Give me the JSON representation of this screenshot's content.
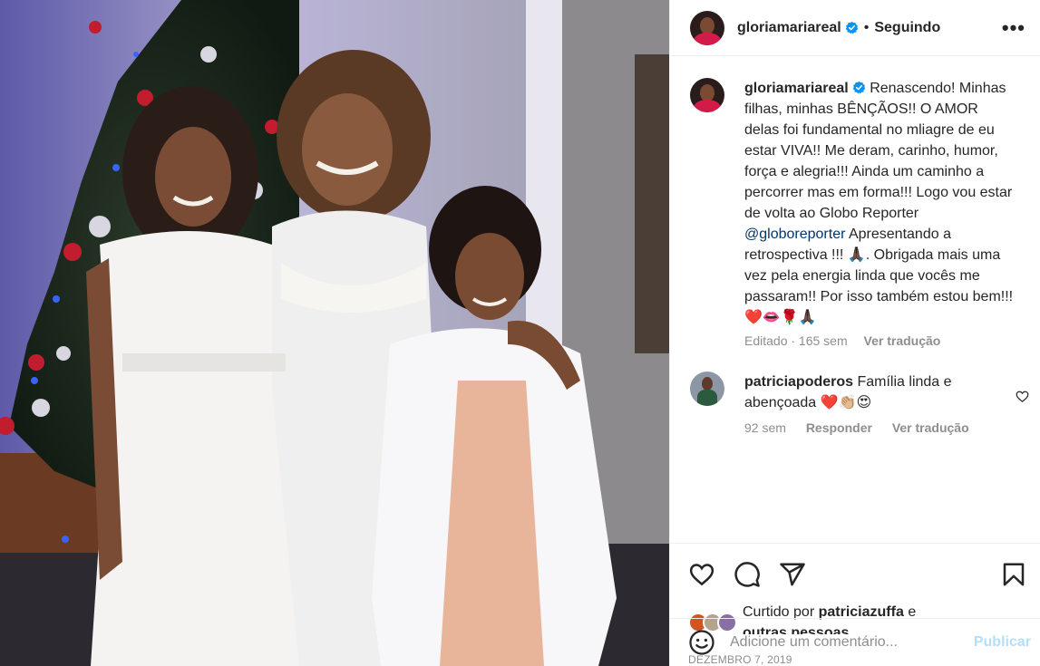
{
  "header": {
    "username": "gloriamariareal",
    "separator": "•",
    "follow_status": "Seguindo",
    "more_label": "•••"
  },
  "caption": {
    "username": "gloriamariareal",
    "text_before_mention": "Renascendo! Minhas filhas, minhas BÊNÇÃOS!! O AMOR delas foi fundamental no mliagre de eu estar VIVA!! Me deram, carinho, humor, força e alegria!!! Ainda um caminho a percorrer mas em forma!!! Logo vou estar de volta ao Globo Reporter",
    "mention": "@globoreporter",
    "text_after_mention": "Apresentando a retrospectiva !!! 🙏🏿. Obrigada mais uma vez pela energia linda que vocês me passaram!! Por isso também estou bem!!! ❤️👄🌹🙏🏿",
    "edited": "Editado · 165 sem",
    "translate": "Ver tradução"
  },
  "comment": {
    "username": "patriciapoderos",
    "text": "Família linda e abençoada ❤️👏🏼😍",
    "time": "92 sem",
    "reply": "Responder",
    "translate": "Ver tradução"
  },
  "likes": {
    "prefix": "Curtido por",
    "user": "patriciazuffa",
    "conj": "e",
    "others": "outras pessoas"
  },
  "date": "DEZEMBRO 7, 2019",
  "add_comment": {
    "placeholder": "Adicione um comentário...",
    "publish": "Publicar"
  },
  "colors": {
    "link": "#00376b",
    "verified": "#0095f6",
    "muted": "#8e8e8e",
    "publish_disabled": "#b2dffc"
  },
  "icons": [
    "more-icon",
    "verified-icon",
    "heart-icon",
    "comment-icon",
    "share-icon",
    "save-icon",
    "emoji-icon",
    "comment-like-icon"
  ]
}
